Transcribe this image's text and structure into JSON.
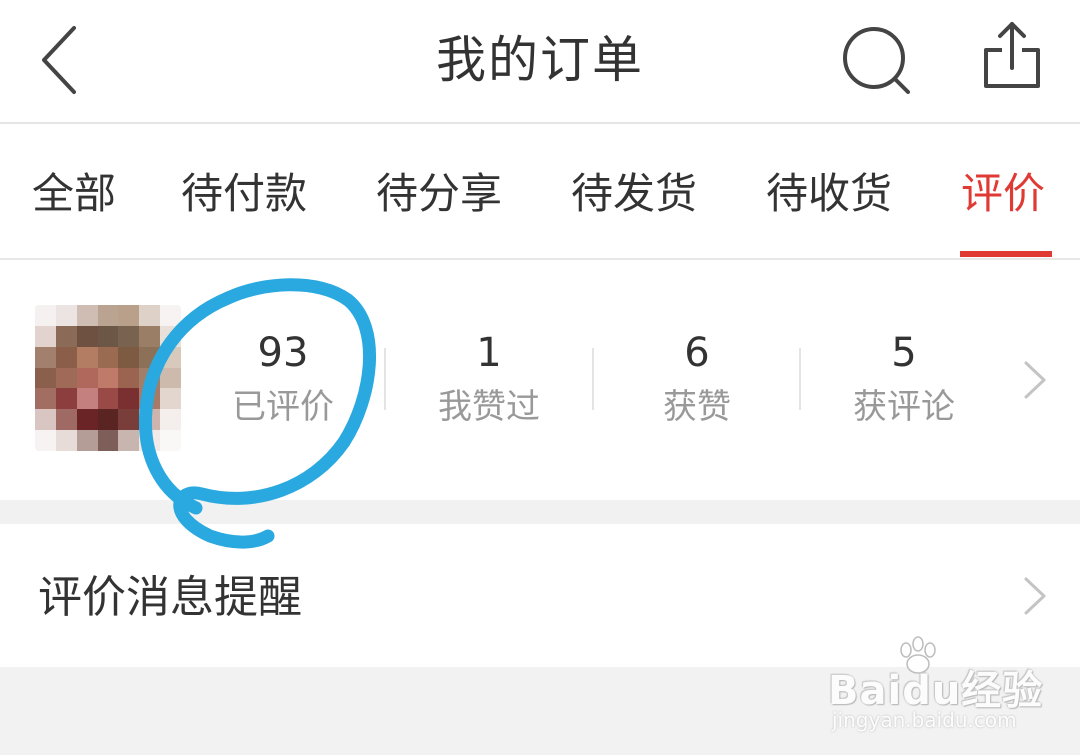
{
  "header": {
    "title": "我的订单"
  },
  "tabs": [
    {
      "label": "全部"
    },
    {
      "label": "待付款"
    },
    {
      "label": "待分享"
    },
    {
      "label": "待发货"
    },
    {
      "label": "待收货"
    },
    {
      "label": "评价",
      "active": true
    }
  ],
  "stats": [
    {
      "value": "93",
      "label": "已评价"
    },
    {
      "value": "1",
      "label": "我赞过"
    },
    {
      "value": "6",
      "label": "获赞"
    },
    {
      "value": "5",
      "label": "获评论"
    }
  ],
  "reminder": {
    "label": "评价消息提醒"
  },
  "watermark": {
    "brand": "Baidu经验",
    "url": "jingyan.baidu.com"
  },
  "colors": {
    "accent": "#e03a35",
    "annotation": "#2aa9e0",
    "text": "#333333",
    "muted": "#999999"
  },
  "icons": [
    "back-arrow-icon",
    "search-icon",
    "share-icon",
    "chevron-right-icon"
  ]
}
